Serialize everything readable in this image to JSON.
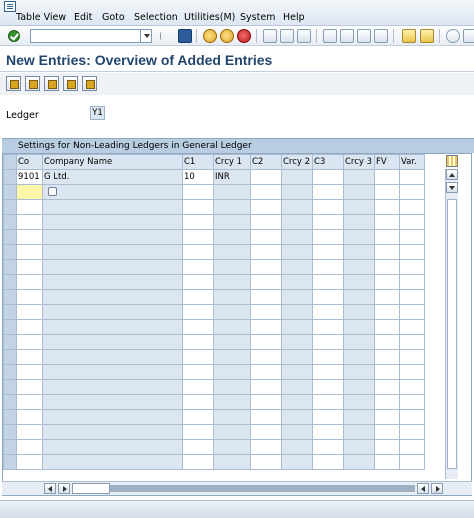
{
  "menu": {
    "items": [
      "Table View",
      "Edit",
      "Goto",
      "Selection",
      "Utilities(M)",
      "System",
      "Help"
    ]
  },
  "toolbar": {
    "command_value": "",
    "icons": [
      "enter-icon",
      "save-icon",
      "back-icon",
      "exit-icon",
      "cancel-icon",
      "print-icon",
      "find-icon",
      "find-next-icon",
      "first-page-icon",
      "previous-page-icon",
      "next-page-icon",
      "last-page-icon",
      "create-session-icon",
      "shortcut-icon",
      "help-icon",
      "customize-layout-icon"
    ]
  },
  "title": "New Entries: Overview of Added Entries",
  "app_toolbar": {
    "icons": [
      "change-display-icon",
      "delete-icon",
      "select-all-icon",
      "select-block-icon",
      "deselect-all-icon"
    ]
  },
  "ledger": {
    "label": "Ledger",
    "value": "Y1"
  },
  "table": {
    "caption": "Settings for Non-Leading Ledgers in General Ledger",
    "columns": [
      "Co",
      "Company Name",
      "C1",
      "Crcy 1",
      "C2",
      "Crcy 2",
      "C3",
      "Crcy 3",
      "FV",
      "Var."
    ],
    "rows": [
      [
        "9101",
        "G Ltd.",
        "10",
        "INR",
        "",
        "",
        "",
        "",
        "",
        ""
      ],
      [
        "",
        "",
        "",
        "",
        "",
        "",
        "",
        "",
        "",
        ""
      ]
    ],
    "empty_rows": 18
  },
  "colors": {
    "title": "#23466f",
    "header_bg": "#dbe5f1",
    "readonly_bg": "#dce6f1",
    "focus_bg": "#fff6a8"
  }
}
